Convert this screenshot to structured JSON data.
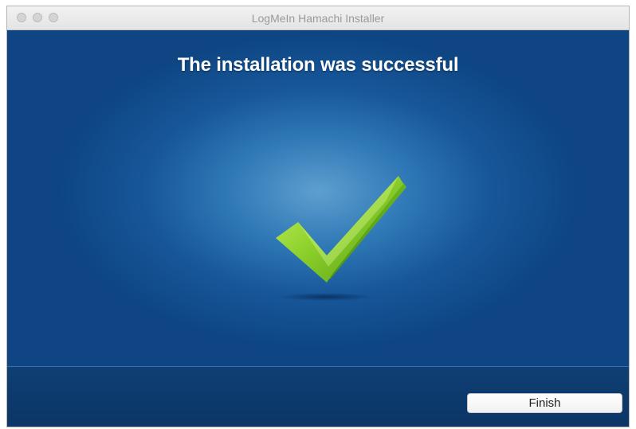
{
  "window": {
    "title": "LogMeIn Hamachi Installer"
  },
  "main": {
    "heading": "The installation was successful",
    "icon": "checkmark-icon"
  },
  "footer": {
    "finish_label": "Finish"
  },
  "colors": {
    "background": "#0e4582",
    "highlight": "#5d9fcf",
    "check": "#8cd12b",
    "button": "#ffffff"
  }
}
